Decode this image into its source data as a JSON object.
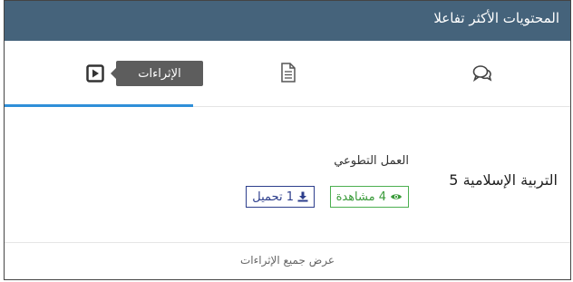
{
  "header": {
    "title": "المحتويات الأكثر تفاعلا"
  },
  "tabs": [
    {
      "key": "enrichments",
      "tooltip": "الإثراءات",
      "icon": "play-square-icon",
      "active": true
    },
    {
      "key": "documents",
      "icon": "document-icon",
      "active": false
    },
    {
      "key": "comments",
      "icon": "comments-icon",
      "active": false
    }
  ],
  "item": {
    "subject": "التربية الإسلامية 5",
    "title": "العمل التطوعي",
    "views_label": "4 مشاهدة",
    "downloads_label": "1 تحميل"
  },
  "footer": {
    "link_label": "عرض جميع الإثراءات"
  },
  "colors": {
    "header_bg": "#45637b",
    "active_tab": "#2f8fd8",
    "views_badge": "#3a9b3a",
    "downloads_badge": "#2d3e8c",
    "tooltip_bg": "#5d5d5d"
  }
}
